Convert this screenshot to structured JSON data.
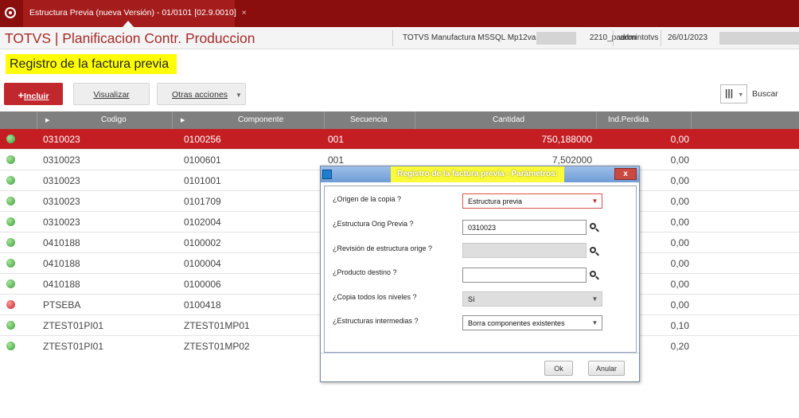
{
  "tab": {
    "title": "Estructura Previa (nueva Versión) - 01/0101 [02.9.0010]",
    "close": "×"
  },
  "header": {
    "app_title": "TOTVS | Planificacion Contr. Produccion",
    "server_left": "TOTVS Manufactura MSSQL Mp12va",
    "server_right": "2210_padron",
    "user": "admintotvs",
    "date": "26/01/2023"
  },
  "page_title": "Registro de la factura previa",
  "toolbar": {
    "incluir_plus": "+",
    "incluir_label": "Incluir",
    "visualizar_label": "Visualizar",
    "otras_label": "Otras acciones",
    "otras_arrow": "▼",
    "view_icon": "|||",
    "view_arrow": "▼",
    "search_label": "Buscar"
  },
  "grid": {
    "columns": [
      "Codigo",
      "Componente",
      "Secuencia",
      "Cantidad",
      "Ind.Perdida"
    ],
    "rows": [
      {
        "status": "green",
        "codigo": "0310023",
        "componente": "0100256",
        "secuencia": "001",
        "cantidad": "750,188000",
        "perdida": "0,00",
        "selected": true
      },
      {
        "status": "green",
        "codigo": "0310023",
        "componente": "0100601",
        "secuencia": "001",
        "cantidad": "7,502000",
        "perdida": "0,00"
      },
      {
        "status": "green",
        "codigo": "0310023",
        "componente": "0101001",
        "secuencia": "",
        "cantidad": "",
        "perdida": "0,00"
      },
      {
        "status": "green",
        "codigo": "0310023",
        "componente": "0101709",
        "secuencia": "",
        "cantidad": "",
        "perdida": "0,00"
      },
      {
        "status": "green",
        "codigo": "0310023",
        "componente": "0102004",
        "secuencia": "",
        "cantidad": "",
        "perdida": "0,00"
      },
      {
        "status": "green",
        "codigo": "0410188",
        "componente": "0100002",
        "secuencia": "",
        "cantidad": "",
        "perdida": "0,00"
      },
      {
        "status": "green",
        "codigo": "0410188",
        "componente": "0100004",
        "secuencia": "",
        "cantidad": "",
        "perdida": "0,00"
      },
      {
        "status": "green",
        "codigo": "0410188",
        "componente": "0100006",
        "secuencia": "",
        "cantidad": "",
        "perdida": "0,00"
      },
      {
        "status": "red",
        "codigo": "PTSEBA",
        "componente": "0100418",
        "secuencia": "",
        "cantidad": "",
        "perdida": "0,00"
      },
      {
        "status": "green",
        "codigo": "ZTEST01PI01",
        "componente": "ZTEST01MP01",
        "secuencia": "",
        "cantidad": "",
        "perdida": "0,10"
      },
      {
        "status": "green",
        "codigo": "ZTEST01PI01",
        "componente": "ZTEST01MP02",
        "secuencia": "",
        "cantidad": "",
        "perdida": "0,20"
      }
    ]
  },
  "dialog": {
    "title": "Registro de la factura previa - Parámetros:",
    "close": "x",
    "params": [
      {
        "label": "¿Origen de la copia ?",
        "value": "Estructura previa"
      },
      {
        "label": "¿Estructura Orig Previa ?",
        "value": "0310023"
      },
      {
        "label": "¿Revisión de estructura orige ?",
        "value": ""
      },
      {
        "label": "¿Producto destino ?",
        "value": ""
      },
      {
        "label": "¿Copia todos los niveles ?",
        "value": "Sí"
      },
      {
        "label": "¿Estructuras intermedias ?",
        "value": "Borra componentes existentes"
      }
    ],
    "dropdown_arrow": "▼",
    "ok_label": "Ok",
    "anular_label": "Anular"
  },
  "colors": {
    "brand_dark": "#8b0e0e",
    "accent_red": "#c41e23",
    "highlight_yellow": "#ffff00",
    "status_green": "#3aa03a",
    "status_red": "#c4242a"
  }
}
